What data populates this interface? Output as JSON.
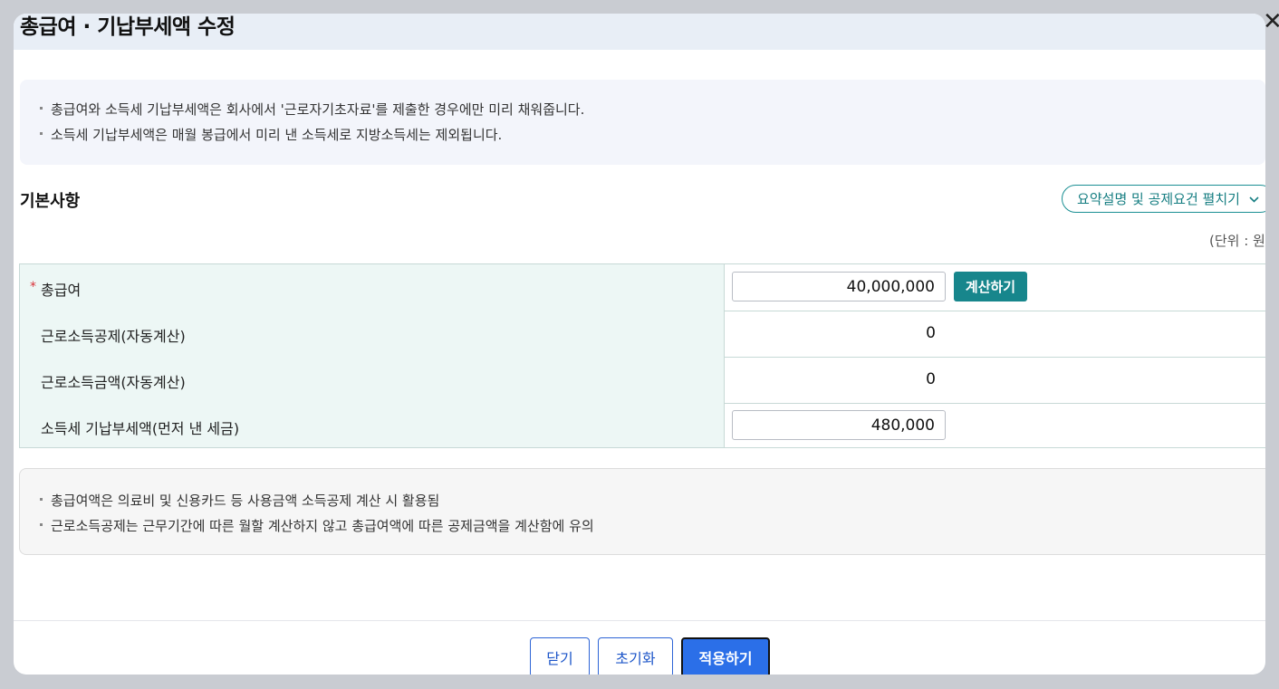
{
  "modal": {
    "title": "총급여 · 기납부세액 수정",
    "close_icon": "close-icon"
  },
  "notice_top": [
    "총급여와 소득세 기납부세액은 회사에서 '근로자기초자료'를 제출한 경우에만 미리 채워줍니다.",
    "소득세 기납부세액은 매월 봉급에서 미리 낸 소득세로 지방소득세는 제외됩니다."
  ],
  "section": {
    "title": "기본사항",
    "expand_label": "요약설명 및 공제요건 펼치기",
    "expand_icon": "chevron-down-icon",
    "unit": "(단위 : 원)"
  },
  "form": {
    "total_pay": {
      "required_mark": "*",
      "label": "총급여",
      "value": "40,000,000",
      "calc_label": "계산하기"
    },
    "earned_income_deduction": {
      "label": "근로소득공제(자동계산)",
      "value": "0"
    },
    "earned_income_amount": {
      "label": "근로소득금액(자동계산)",
      "value": "0"
    },
    "prepaid_tax": {
      "label": "소득세 기납부세액(먼저 낸 세금)",
      "value": "480,000"
    }
  },
  "notice_bottom": [
    "총급여액은 의료비 및 신용카드 등 사용금액 소득공제 계산 시 활용됨",
    "근로소득공제는 근무기간에 따른 월할 계산하지 않고 총급여액에 따른 공제금액을 계산함에 유의"
  ],
  "footer": {
    "close_label": "닫기",
    "reset_label": "초기화",
    "apply_label": "적용하기"
  },
  "colors": {
    "accent_teal": "#17868c",
    "primary_blue": "#2b6fe8",
    "label_bg": "#edf7f5"
  }
}
